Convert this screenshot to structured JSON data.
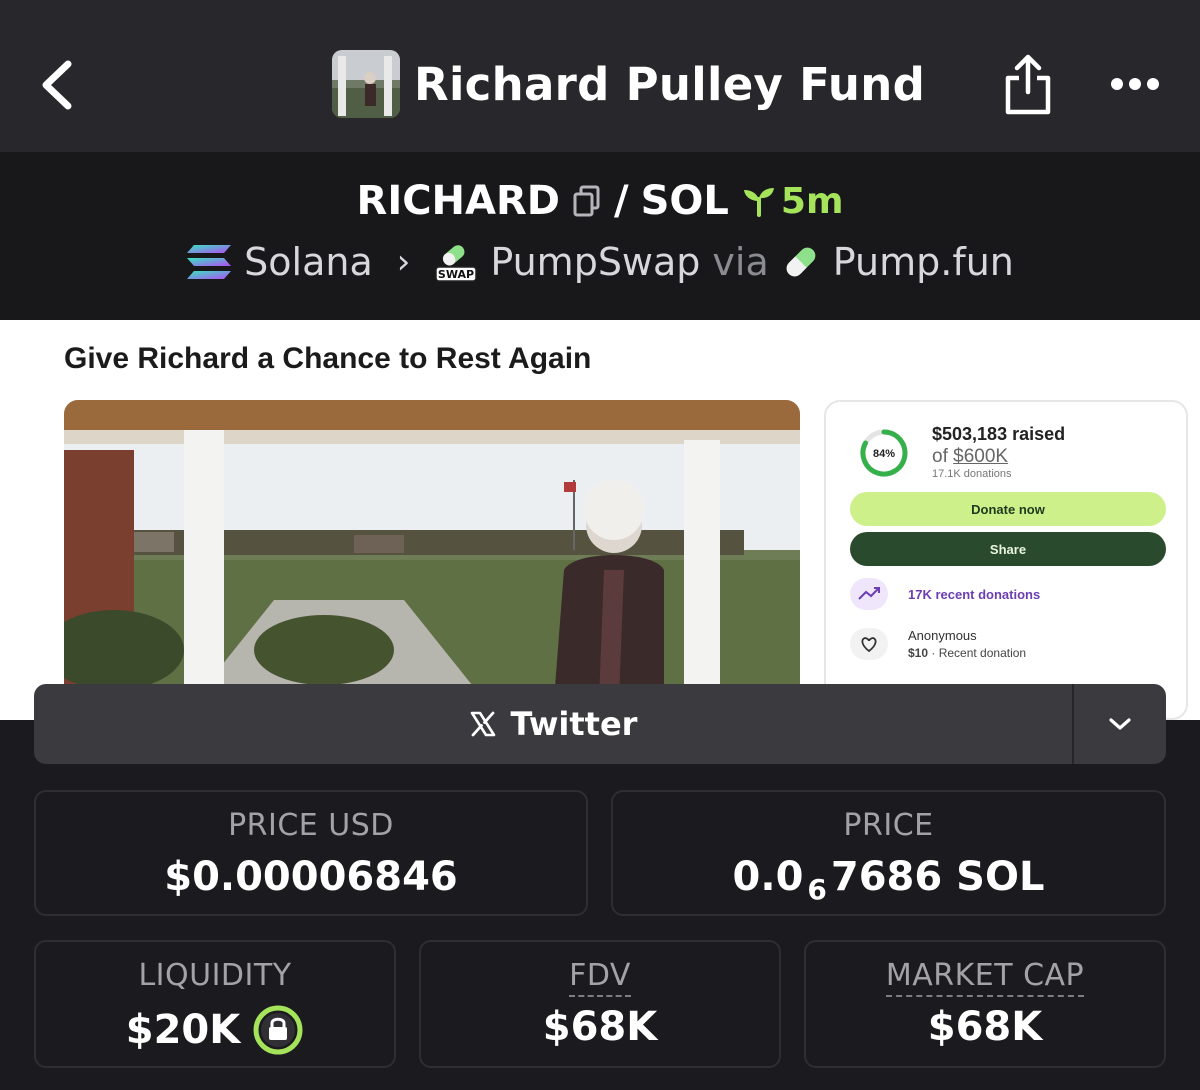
{
  "header": {
    "title": "Richard Pulley Fund"
  },
  "pair": {
    "base": "RICHARD",
    "separator": "/",
    "quote": "SOL",
    "age": "5m"
  },
  "route": {
    "chain": "Solana",
    "dex": "PumpSwap",
    "via": "via",
    "launchpad": "Pump.fun",
    "swap_badge": "SWAP"
  },
  "banner": {
    "headline": "Give Richard a Chance to Rest Again",
    "raised": "$503,183 raised",
    "goal_prefix": "of ",
    "goal_amount": "$600K",
    "donation_count": "17.1K donations",
    "percent": "84%",
    "donate_label": "Donate now",
    "share_label": "Share",
    "recent_label": "17K recent donations",
    "donor_name": "Anonymous",
    "donor_amount": "$10",
    "donor_note": "Recent donation"
  },
  "social": {
    "label": "Twitter"
  },
  "stats": {
    "price_usd_label": "PRICE USD",
    "price_usd": "$0.00006846",
    "price_label": "PRICE",
    "price_prefix": "0.0",
    "price_zeros": "6",
    "price_digits": "7686 SOL",
    "liquidity_label": "LIQUIDITY",
    "liquidity": "$20K",
    "fdv_label": "FDV",
    "fdv": "$68K",
    "mcap_label": "MARKET CAP",
    "mcap": "$68K"
  },
  "colors": {
    "accent_green": "#a4e35a",
    "background": "#1b1b1f"
  }
}
